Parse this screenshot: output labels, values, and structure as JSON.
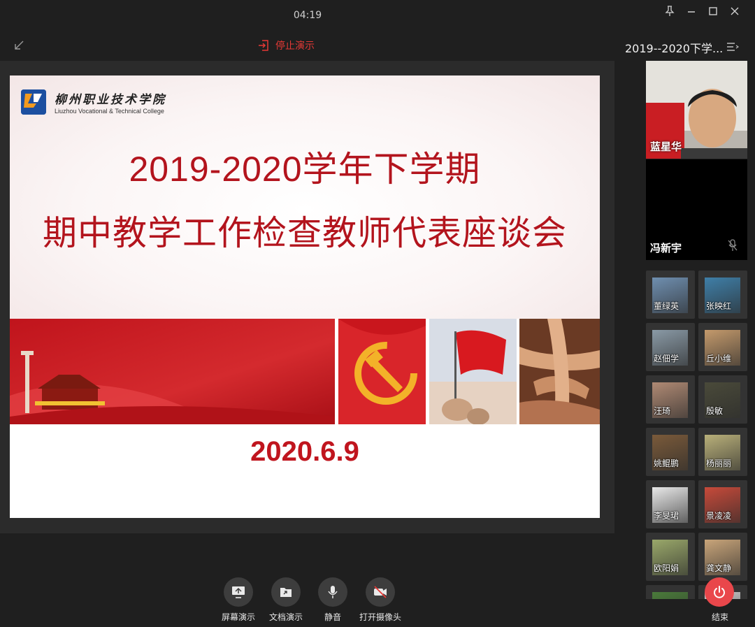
{
  "header": {
    "timer": "04:19",
    "stop_presenting_label": "停止演示"
  },
  "slide": {
    "logo_cn": "柳州职业技术学院",
    "logo_en": "Liuzhou Vocational & Technical College",
    "logo_mark_text": "LVTC",
    "title_line1": "2019-2020学年下学期",
    "title_line2": "期中教学工作检查教师代表座谈会",
    "date": "2020.6.9"
  },
  "sidebar": {
    "meeting_title": "2019--2020下学...",
    "main_speakers": [
      {
        "name": "蓝星华",
        "muted": false
      },
      {
        "name": "冯新宇",
        "muted": true
      }
    ],
    "participants": [
      {
        "name": "董绿英",
        "color": "#6f8fb0"
      },
      {
        "name": "张映红",
        "color": "#3f7fa8"
      },
      {
        "name": "赵佃学",
        "color": "#8a9aa6"
      },
      {
        "name": "丘小维",
        "color": "#c49a6c"
      },
      {
        "name": "汪琦",
        "color": "#b08a74"
      },
      {
        "name": "殷敏",
        "color": "#4a4a3a"
      },
      {
        "name": "姚鲲鹏",
        "color": "#7a5a3a"
      },
      {
        "name": "杨丽丽",
        "color": "#b9b07a"
      },
      {
        "name": "李旻珺",
        "color": "#e8e8e8"
      },
      {
        "name": "景凌凌",
        "color": "#c74a3a"
      },
      {
        "name": "欧阳娟",
        "color": "#9aa86a"
      },
      {
        "name": "龚文静",
        "color": "#c9a57a"
      },
      {
        "name": "",
        "color": "#4a7a3a"
      },
      {
        "name": "",
        "color": "#cfcfcf"
      }
    ]
  },
  "toolbar": {
    "screen_share_label": "屏幕演示",
    "doc_share_label": "文档演示",
    "mute_label": "静音",
    "camera_label": "打开摄像头",
    "end_label": "结束"
  },
  "colors": {
    "accent_red": "#e53935",
    "title_red": "#b3141d",
    "end_button": "#e9474b"
  }
}
